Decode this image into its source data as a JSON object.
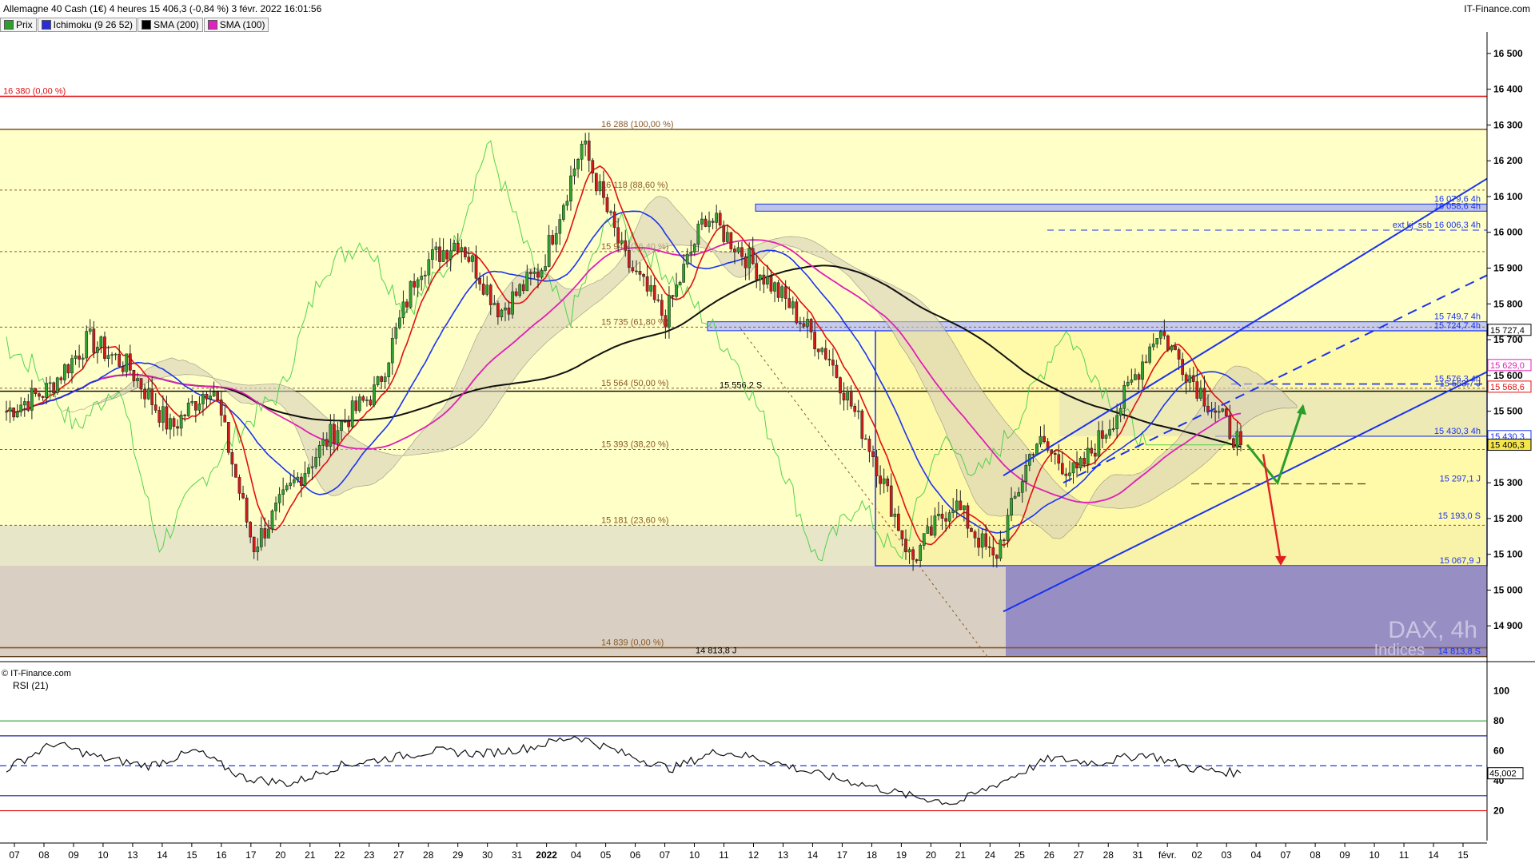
{
  "header": {
    "title": "Allemagne 40 Cash (1€) 4 heures 15 406,3 (-0,84 %) 3 févr. 2022 16:01:56",
    "site": "IT-Finance.com",
    "watermark_symbol": "DAX, 4h",
    "watermark_sub": "Indices",
    "copyright": "© IT-Finance.com"
  },
  "legend": [
    {
      "label": "Prix",
      "color": "#2e9e2e"
    },
    {
      "label": "Ichimoku (9 26 52)",
      "color": "#2b2bd8"
    },
    {
      "label": "SMA (200)",
      "color": "#000000"
    },
    {
      "label": "SMA (100)",
      "color": "#e020c0"
    }
  ],
  "colors": {
    "bull": "#2ea32e",
    "bear": "#d11a1a",
    "tenkan": "#e01010",
    "kijun": "#1a33ee",
    "chikou": "#3fcf3f",
    "sma200": "#111111",
    "sma100": "#e01fb5",
    "fib": "#8a5a2a",
    "channel": "#1a33ee",
    "zone_yellow": "#ffffc8",
    "zone_low": "#d9cfc2",
    "zone_purple": "#8f86c4"
  },
  "chart_data": [
    {
      "type": "candlestick",
      "ylim": [
        14800,
        16560
      ],
      "y_ticks": [
        {
          "v": 16500,
          "label": "16 500"
        },
        {
          "v": 16400,
          "label": "16 400"
        },
        {
          "v": 16300,
          "label": "16 300"
        },
        {
          "v": 16200,
          "label": "16 200"
        },
        {
          "v": 16100,
          "label": "16 100"
        },
        {
          "v": 16000,
          "label": "16 000"
        },
        {
          "v": 15900,
          "label": "15 900"
        },
        {
          "v": 15800,
          "label": "15 800"
        },
        {
          "v": 15700,
          "label": "15 700"
        },
        {
          "v": 15600,
          "label": "15 600"
        },
        {
          "v": 15500,
          "label": "15 500"
        },
        {
          "v": 15300,
          "label": "15 300"
        },
        {
          "v": 15200,
          "label": "15 200"
        },
        {
          "v": 15100,
          "label": "15 100"
        },
        {
          "v": 15000,
          "label": "15 000"
        },
        {
          "v": 14900,
          "label": "14 900"
        }
      ],
      "x_labels": [
        "07",
        "08",
        "09",
        "10",
        "13",
        "14",
        "15",
        "16",
        "17",
        "20",
        "21",
        "22",
        "23",
        "27",
        "28",
        "29",
        "30",
        "31",
        "2022",
        "04",
        "05",
        "06",
        "07",
        "10",
        "11",
        "12",
        "13",
        "14",
        "17",
        "18",
        "19",
        "20",
        "21",
        "24",
        "25",
        "26",
        "27",
        "28",
        "31",
        "févr.",
        "02",
        "03",
        "04",
        "07",
        "08",
        "09",
        "10",
        "11",
        "14",
        "15"
      ],
      "levels": [
        {
          "v": 16380,
          "label": "16 380 (0,00 %)",
          "color": "#e01010",
          "style": "solid",
          "side": "left"
        },
        {
          "v": 16288,
          "label": "16 288 (100,00 %)",
          "color": "#8a5a2a",
          "style": "solid",
          "side": "fib"
        },
        {
          "v": 16118,
          "label": "16 118 (88,60 %)",
          "color": "#8a5a2a",
          "style": "dot",
          "side": "fib"
        },
        {
          "v": 15946,
          "label": "15 946 (76,40 %)",
          "color": "#8a5a2a",
          "style": "dot",
          "side": "fib"
        },
        {
          "v": 15735,
          "label": "15 735 (61,80 %)",
          "color": "#8a5a2a",
          "style": "dot",
          "side": "fib"
        },
        {
          "v": 15564,
          "label": "15 564 (50,00 %)",
          "color": "#8a5a2a",
          "style": "dot",
          "side": "fib"
        },
        {
          "v": 15393,
          "label": "15 393 (38,20 %)",
          "color": "#8a5a2a",
          "style": "dot",
          "side": "fib"
        },
        {
          "v": 15181,
          "label": "15 181 (23,60 %)",
          "color": "#8a5a2a",
          "style": "dot",
          "side": "fib"
        },
        {
          "v": 14839,
          "label": "14 839 (0,00 %)",
          "color": "#8a5a2a",
          "style": "solid",
          "side": "fib"
        }
      ],
      "right_labels": [
        {
          "v": 16079,
          "label": "16 079,6 4h"
        },
        {
          "v": 16059,
          "label": "16 058,6 4h"
        },
        {
          "v": 16006,
          "label": "ext kj_ssb 16 006,3 4h"
        },
        {
          "v": 15750,
          "label": "15 749,7 4h"
        },
        {
          "v": 15725,
          "label": "15 724,7 4h"
        },
        {
          "v": 15576,
          "label": "15 576,3 4h"
        },
        {
          "v": 15563,
          "label": "15 563,7 J"
        },
        {
          "v": 15430,
          "label": "15 430,3 4h"
        },
        {
          "v": 15297,
          "label": "15 297,1 J"
        },
        {
          "v": 15193,
          "label": "15 193,0 S"
        },
        {
          "v": 15068,
          "label": "15 067,9 J"
        },
        {
          "v": 14814,
          "label": "14 813,8 S"
        }
      ],
      "mid_labels": [
        {
          "v": 15556,
          "label": "15 556,2 S"
        },
        {
          "v": 14814,
          "label": "14 813,8 J"
        }
      ],
      "price_tags": [
        {
          "v": 15727.4,
          "label": "15 727,4",
          "bg": "#ffffff",
          "fg": "#000000"
        },
        {
          "v": 15629.0,
          "label": "15 629,0",
          "bg": "#ffffff",
          "fg": "#e01fb5"
        },
        {
          "v": 15568.6,
          "label": "15 568,6",
          "bg": "#ffffff",
          "fg": "#e01010"
        },
        {
          "v": 15430.3,
          "label": "15 430,3",
          "bg": "#ffffff",
          "fg": "#1a33ee"
        },
        {
          "v": 15406.3,
          "label": "15 406,3",
          "bg": "#f5e64a",
          "fg": "#000000"
        }
      ],
      "anchors": {
        "p0": 15500,
        "p1": 15560,
        "p2": 15700,
        "p3": 15620,
        "p4": 15450,
        "p5": 15580,
        "p6": 15120,
        "p7": 15300,
        "p8": 15450,
        "p9": 15560,
        "p10": 15900,
        "p11": 15980,
        "p12": 15780,
        "p13": 15900,
        "p14": 16250,
        "p15": 15930,
        "p16": 15760,
        "p17": 16050,
        "p18": 15930,
        "p19": 15800,
        "p20": 15650,
        "p21": 15400,
        "p22": 15080,
        "p23": 15250,
        "p24": 15080,
        "p25": 15420,
        "p26": 15320,
        "p27": 15500,
        "p28": 15730,
        "p29": 15560,
        "p30": 15406
      }
    },
    {
      "type": "line",
      "title": "RSI (21)",
      "ylim": [
        0,
        110
      ],
      "y_ticks": [
        {
          "v": 100,
          "label": "100"
        },
        {
          "v": 80,
          "label": "80"
        },
        {
          "v": 60,
          "label": "60"
        },
        {
          "v": 40,
          "label": "40"
        },
        {
          "v": 20,
          "label": "20"
        }
      ],
      "levels": [
        {
          "v": 80,
          "color": "#2a9e2a"
        },
        {
          "v": 70,
          "color": "#2020a0"
        },
        {
          "v": 50,
          "color": "#2a3ad6",
          "style": "dash"
        },
        {
          "v": 30,
          "color": "#2020a0"
        },
        {
          "v": 20,
          "color": "#e01010"
        }
      ],
      "last_tag": "45,002",
      "anchors": [
        48,
        65,
        55,
        50,
        60,
        42,
        38,
        50,
        55,
        60,
        58,
        62,
        70,
        58,
        48,
        60,
        54,
        45,
        38,
        30,
        25,
        40,
        55,
        52,
        58,
        48,
        45
      ]
    }
  ]
}
